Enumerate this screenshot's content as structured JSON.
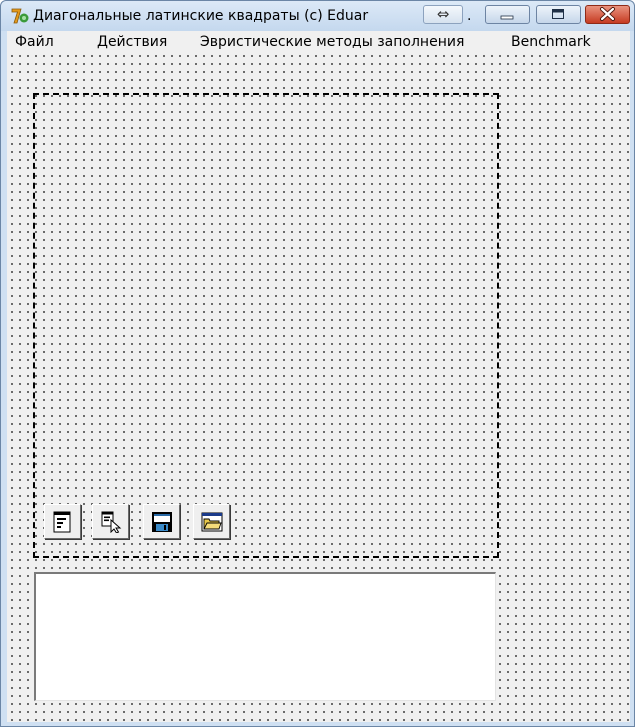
{
  "window": {
    "title": "Диагональные латинские квадраты (c) Eduar",
    "title_suffix": ".",
    "resize_glyph": "⇔"
  },
  "menu": {
    "items": [
      {
        "label": "Файл"
      },
      {
        "label": "Действия"
      },
      {
        "label": "Эвристические методы заполнения"
      },
      {
        "label": "Benchmark"
      }
    ]
  },
  "toolbar": {
    "buttons": [
      {
        "icon": "properties-icon"
      },
      {
        "icon": "select-pointer-icon"
      },
      {
        "icon": "save-floppy-icon"
      },
      {
        "icon": "open-folder-icon"
      }
    ]
  },
  "output_memo": {
    "value": ""
  },
  "colors": {
    "titlebar": "#c4d8ee",
    "menubar": "#f0f0f0",
    "close_button": "#c63b22"
  }
}
